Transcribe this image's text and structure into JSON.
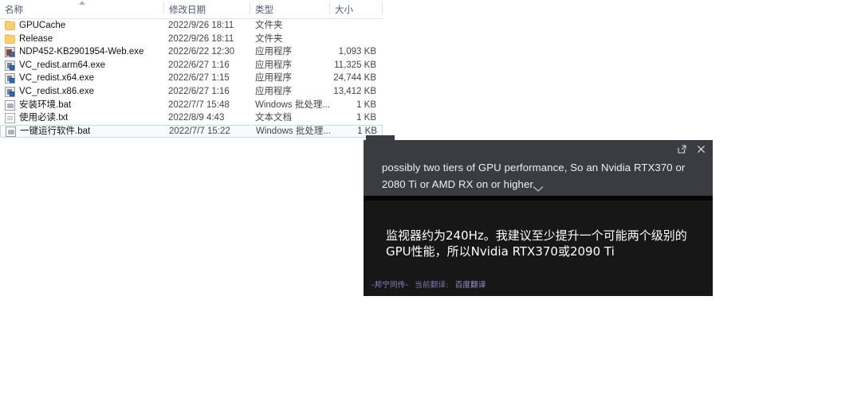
{
  "explorer": {
    "columns": [
      {
        "key": "name",
        "label": "名称"
      },
      {
        "key": "date",
        "label": "修改日期"
      },
      {
        "key": "type",
        "label": "类型"
      },
      {
        "key": "size",
        "label": "大小"
      }
    ],
    "sort": {
      "column": "名称",
      "direction": "ascending",
      "icon": "sort-ascending-caret"
    },
    "rows": [
      {
        "icon": "folder-icon",
        "name": "GPUCache",
        "date": "2022/9/26 18:11",
        "type": "文件夹",
        "size": "",
        "selected": false
      },
      {
        "icon": "folder-icon",
        "name": "Release",
        "date": "2022/9/26 18:11",
        "type": "文件夹",
        "size": "",
        "selected": false
      },
      {
        "icon": "installer-icon",
        "name": "NDP452-KB2901954-Web.exe",
        "date": "2022/6/22 12:30",
        "type": "应用程序",
        "size": "1,093 KB",
        "selected": false
      },
      {
        "icon": "installer-icon",
        "name": "VC_redist.arm64.exe",
        "date": "2022/6/27 1:16",
        "type": "应用程序",
        "size": "11,325 KB",
        "selected": false
      },
      {
        "icon": "installer-icon",
        "name": "VC_redist.x64.exe",
        "date": "2022/6/27 1:15",
        "type": "应用程序",
        "size": "24,744 KB",
        "selected": false
      },
      {
        "icon": "installer-icon",
        "name": "VC_redist.x86.exe",
        "date": "2022/6/27 1:16",
        "type": "应用程序",
        "size": "13,412 KB",
        "selected": false
      },
      {
        "icon": "batch-file-icon",
        "name": "安装环境.bat",
        "date": "2022/7/7 15:48",
        "type": "Windows 批处理...",
        "size": "1 KB",
        "selected": false
      },
      {
        "icon": "text-file-icon",
        "name": "使用必读.txt",
        "date": "2022/8/9 4:43",
        "type": "文本文档",
        "size": "1 KB",
        "selected": false
      },
      {
        "icon": "batch-file-icon",
        "name": "一键运行软件.bat",
        "date": "2022/7/7 15:22",
        "type": "Windows 批处理...",
        "size": "1 KB",
        "selected": true
      }
    ]
  },
  "translation_panel": {
    "source_text": "possibly two tiers of GPU performance, So an Nvidia RTX370 or 2080 Ti or AMD RX on or higher",
    "translated_text": "监视器约为240Hz。我建议至少提升一个可能两个级别的GPU性能，所以Nvidia RTX370或2090 Ti",
    "expand_icon": "open-in-new-window-icon",
    "close_icon": "close-icon",
    "collapse_icon": "chevron-down-icon",
    "footer": {
      "brand": "-邦宁同传-",
      "label": "当前翻译:",
      "engine": "百度翻译"
    },
    "colors": {
      "top_bg": "#3a3c41",
      "body_bg": "#171717",
      "footer_text": "#8b85c9",
      "source_text": "#f0f0f0",
      "translated_text": "#ffffff"
    }
  }
}
